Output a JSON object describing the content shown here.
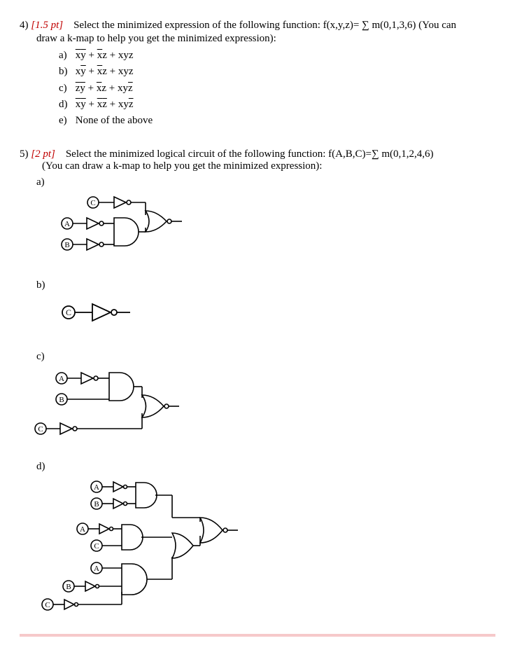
{
  "q4": {
    "number": "4)",
    "points": "[1.5 pt]",
    "prompt_a": "Select the minimized expression of the following function: f(x,y,z)= ∑ m(0,1,3,6) (You can",
    "prompt_b": "draw a k-map to help you get the minimized expression):",
    "opts": {
      "a_l": "a)",
      "a_e": [
        "x̄ȳ",
        " + ",
        "x̄z",
        " + ",
        "xyz"
      ],
      "b_l": "b)",
      "b_e": [
        "xȳ",
        " + ",
        "x̄z",
        " + ",
        "xyz"
      ],
      "c_l": "c)",
      "c_e": [
        "z̄ȳ",
        " + ",
        "x̄z",
        " + ",
        "xyz̄"
      ],
      "d_l": "d)",
      "d_e": [
        "x̄ȳ",
        " + ",
        "x̄z̄",
        " + ",
        "xyz̄"
      ],
      "e_l": "e)",
      "e_e": "None of the above"
    }
  },
  "q5": {
    "number": "5)",
    "points": "[2 pt]",
    "prompt_a": "Select the minimized logical circuit of the following function: f(A,B,C)=∑ m(0,1,2,4,6)",
    "prompt_b": "(You can draw a k-map to help you get the minimized expression):",
    "a_l": "a)",
    "b_l": "b)",
    "c_l": "c)",
    "d_l": "d)"
  }
}
